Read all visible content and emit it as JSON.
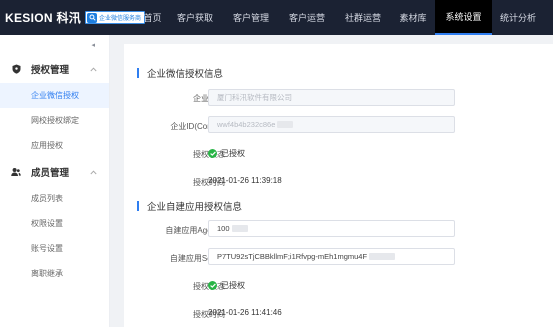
{
  "brand": {
    "name": "KESION 科汛",
    "badge": "企业微信服务商"
  },
  "nav": {
    "items": [
      {
        "label": "首页",
        "active": false
      },
      {
        "label": "客户获取",
        "active": false
      },
      {
        "label": "客户管理",
        "active": false
      },
      {
        "label": "客户运营",
        "active": false
      },
      {
        "label": "社群运营",
        "active": false
      },
      {
        "label": "素材库",
        "active": false
      },
      {
        "label": "系统设置",
        "active": true
      },
      {
        "label": "统计分析",
        "active": false
      }
    ]
  },
  "sidebar": {
    "collapse_icon": "◂",
    "groups": [
      {
        "label": "授权管理",
        "icon": "shield-icon",
        "items": [
          {
            "label": "企业微信授权",
            "active": true
          },
          {
            "label": "网校授权绑定",
            "active": false
          },
          {
            "label": "应用授权",
            "active": false
          }
        ]
      },
      {
        "label": "成员管理",
        "icon": "users-icon",
        "items": [
          {
            "label": "成员列表",
            "active": false
          },
          {
            "label": "权限设置",
            "active": false
          },
          {
            "label": "账号设置",
            "active": false
          },
          {
            "label": "离职继承",
            "active": false
          }
        ]
      }
    ]
  },
  "section1": {
    "title": "企业微信授权信息",
    "corp_name_label": "企业全称",
    "corp_name_value": "厦门科汛软件有限公司",
    "corp_id_label": "企业ID(CorpID)",
    "corp_id_value": "wwf4b4b232c86e",
    "status_label": "授权状态",
    "status_value": "已授权",
    "time_label": "授权时间",
    "time_value": "2021-01-26 11:39:18"
  },
  "section2": {
    "title": "企业自建应用授权信息",
    "agent_label": "自建应用AgentId",
    "agent_value": "100",
    "secret_label": "自建应用Secret",
    "secret_value": "P7TU92sTjCBBkllmF;i1Rfvpg-mEh1mgmu4F",
    "status_label": "授权状态",
    "status_value": "已授权",
    "time_label": "授权时间",
    "time_value": "2021-01-26 11:41:46"
  },
  "colors": {
    "accent": "#2f7ef0",
    "topbar": "#1b2233",
    "success": "#28b446"
  }
}
